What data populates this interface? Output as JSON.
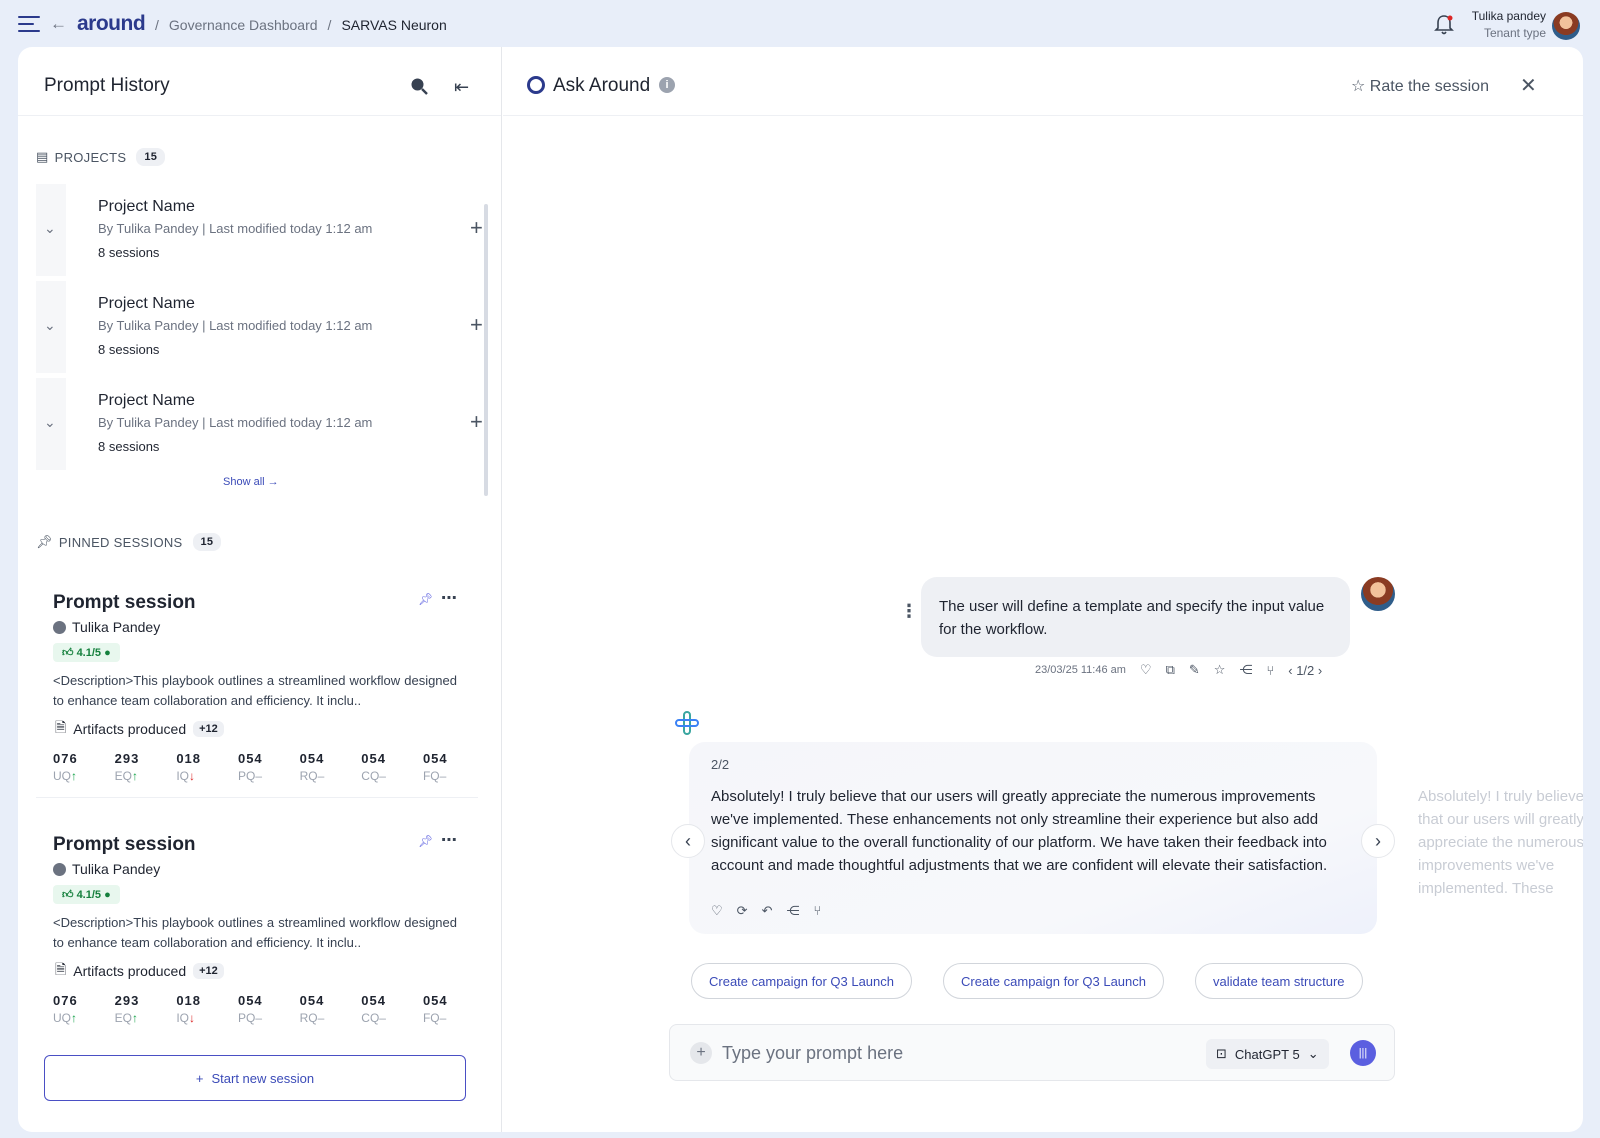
{
  "brand": {
    "logo": "around"
  },
  "breadcrumb": {
    "parent": "Governance Dashboard",
    "current": "SARVAS Neuron"
  },
  "user": {
    "name": "Tulika pandey",
    "tenant": "Tenant type"
  },
  "sidebar": {
    "title": "Prompt History",
    "projects_label": "PROJECTS",
    "projects_count": "15",
    "projects": [
      {
        "name": "Project Name",
        "author": "By Tulika Pandey",
        "modified": "Last modified today 1:12 am",
        "sessions": "8 sessions"
      },
      {
        "name": "Project Name",
        "author": "By Tulika Pandey",
        "modified": "Last modified today 1:12 am",
        "sessions": "8 sessions"
      },
      {
        "name": "Project Name",
        "author": "By Tulika Pandey",
        "modified": "Last modified today 1:12 am",
        "sessions": "8 sessions"
      }
    ],
    "show_all": "Show all →",
    "pinned_label": "PINNED SESSIONS",
    "pinned_count": "15",
    "sessions": [
      {
        "title": "Prompt session",
        "author": "Tulika Pandey",
        "rating": "4.1/5",
        "description": "<Description>This playbook outlines a streamlined workflow designed to enhance team collaboration and efficiency. It inclu..",
        "artifacts": "Artifacts produced",
        "artifacts_more": "+12",
        "stats": [
          {
            "v": "076",
            "k": "UQ",
            "trend": "↑"
          },
          {
            "v": "293",
            "k": "EQ",
            "trend": "↑"
          },
          {
            "v": "018",
            "k": "IQ",
            "trend": "↓"
          },
          {
            "v": "054",
            "k": "PQ",
            "trend": "–"
          },
          {
            "v": "054",
            "k": "RQ",
            "trend": "–"
          },
          {
            "v": "054",
            "k": "CQ",
            "trend": "–"
          },
          {
            "v": "054",
            "k": "FQ",
            "trend": "–"
          }
        ]
      },
      {
        "title": "Prompt session",
        "author": "Tulika Pandey",
        "rating": "4.1/5",
        "description": "<Description>This playbook outlines a streamlined workflow designed to enhance team collaboration and efficiency. It inclu..",
        "artifacts": "Artifacts produced",
        "artifacts_more": "+12",
        "stats": [
          {
            "v": "076",
            "k": "UQ",
            "trend": "↑"
          },
          {
            "v": "293",
            "k": "EQ",
            "trend": "↑"
          },
          {
            "v": "018",
            "k": "IQ",
            "trend": "↓"
          },
          {
            "v": "054",
            "k": "PQ",
            "trend": "–"
          },
          {
            "v": "054",
            "k": "RQ",
            "trend": "–"
          },
          {
            "v": "054",
            "k": "CQ",
            "trend": "–"
          },
          {
            "v": "054",
            "k": "FQ",
            "trend": "–"
          }
        ]
      }
    ],
    "new_session": "Start new session"
  },
  "chat": {
    "title": "Ask Around",
    "rate": "Rate the session",
    "user_message": "The user will define a template and specify the input value for the workflow.",
    "user_timestamp": "23/03/25 11:46 am",
    "user_pager": "1/2",
    "answer_pager": "2/2",
    "answer": "Absolutely! I truly believe that our users will greatly appreciate the numerous improvements we've implemented. These enhancements not only streamline their experience but also add significant value to the overall functionality of our platform. We have taken their feedback into account and made thoughtful adjustments that we are confident will elevate their satisfaction.",
    "suggestions": [
      "Create campaign for Q3 Launch",
      "Create campaign for Q3 Launch",
      "validate team structure"
    ],
    "input_placeholder": "Type your prompt here",
    "model": "ChatGPT 5"
  }
}
